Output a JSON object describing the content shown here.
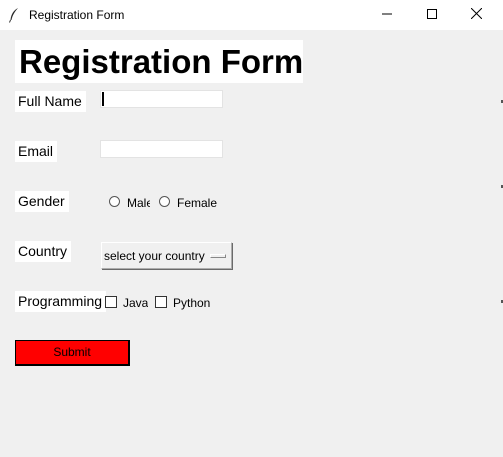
{
  "window": {
    "title": "Registration Form",
    "controls": {
      "minimize_icon": "minimize-icon",
      "maximize_icon": "maximize-icon",
      "close_icon": "close-icon"
    }
  },
  "form": {
    "heading": "Registration Form",
    "full_name": {
      "label": "Full Name",
      "value": ""
    },
    "email": {
      "label": "Email",
      "value": ""
    },
    "gender": {
      "label": "Gender",
      "options": [
        "Male",
        "Female"
      ],
      "selected": null
    },
    "country": {
      "label": "Country",
      "selected_text": "select your country"
    },
    "programming": {
      "label": "Programming",
      "options": [
        "Java",
        "Python"
      ],
      "checked": [
        false,
        false
      ]
    },
    "submit_label": "Submit"
  },
  "colors": {
    "window_bg": "#f0f0f0",
    "label_bg": "#ffffff",
    "submit_bg": "#ff0000"
  }
}
